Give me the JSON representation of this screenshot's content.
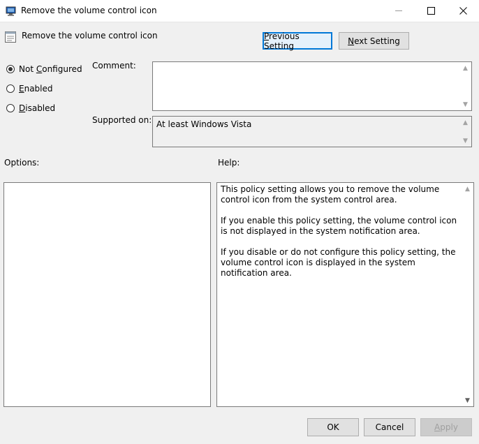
{
  "window": {
    "title": "Remove the volume control icon",
    "colors": {
      "accent": "#0078d7",
      "icon_blue": "#1e5fb4"
    }
  },
  "header": {
    "setting_name": "Remove the volume control icon",
    "previous_prefix": "P",
    "previous_rest": "revious Setting",
    "next_prefix": "N",
    "next_rest": "ext Setting"
  },
  "state": {
    "selected": "not_configured",
    "options": [
      {
        "id": "not_configured",
        "prefix": "Not ",
        "mnemonic": "C",
        "rest": "onfigured"
      },
      {
        "id": "enabled",
        "prefix": "",
        "mnemonic": "E",
        "rest": "nabled"
      },
      {
        "id": "disabled",
        "prefix": "",
        "mnemonic": "D",
        "rest": "isabled"
      }
    ]
  },
  "comment": {
    "label": "Comment:",
    "value": ""
  },
  "supported": {
    "label": "Supported on:",
    "value": "At least Windows Vista"
  },
  "options_panel": {
    "label": "Options:"
  },
  "help_panel": {
    "label": "Help:",
    "paragraphs": [
      "This policy setting allows you to remove the volume control icon from the system control area.",
      "If you enable this policy setting, the volume control icon is not displayed in the system notification area.",
      "If you disable or do not configure this policy setting, the volume control icon is displayed in the system notification area."
    ]
  },
  "footer": {
    "ok": "OK",
    "cancel": "Cancel",
    "apply_prefix": "A",
    "apply_rest": "pply"
  }
}
